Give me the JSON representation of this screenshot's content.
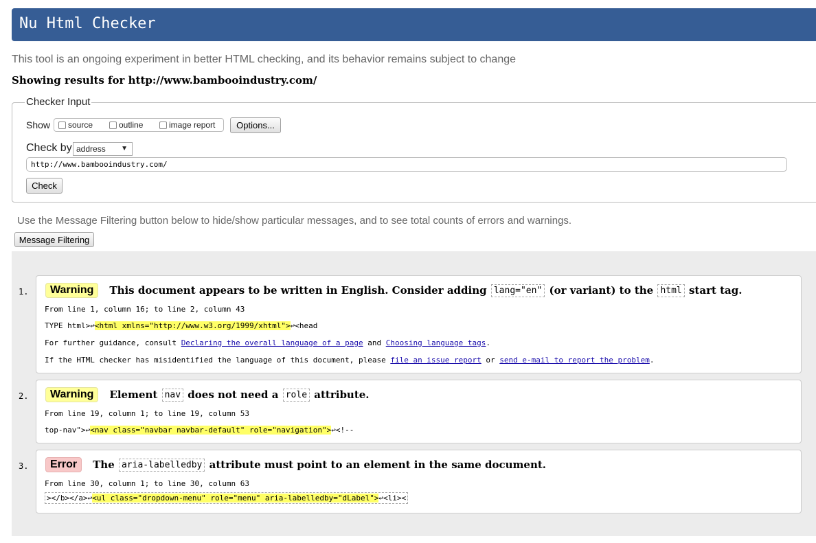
{
  "app": {
    "title": "Nu Html Checker"
  },
  "subtitle": "This tool is an ongoing experiment in better HTML checking, and its behavior remains subject to change",
  "showing_results": "Showing results for http://www.bambooindustry.com/",
  "checker_input": {
    "legend": "Checker Input",
    "show_label": "Show",
    "show_options": [
      {
        "label": "source",
        "checked": false
      },
      {
        "label": "outline",
        "checked": false
      },
      {
        "label": "image report",
        "checked": false
      }
    ],
    "options_button": "Options...",
    "check_by_label": "Check by",
    "check_by_value": "address",
    "url_value": "http://www.bambooindustry.com/",
    "check_button": "Check"
  },
  "filtering": {
    "text": "Use the Message Filtering button below to hide/show particular messages, and to see total counts of errors and warnings.",
    "button": "Message Filtering"
  },
  "messages": [
    {
      "num": "1.",
      "type": "Warning",
      "text1": "This document appears to be written in English. Consider adding",
      "code1": "lang=\"en\"",
      "text2": "(or variant) to the",
      "code2": "html",
      "text3": "start tag.",
      "location": "From line 1, column 16; to line 2, column 43",
      "extract_pre": "TYPE html>↩",
      "extract_hl": "<html xmlns=\"http://www.w3.org/1999/xhtml\">",
      "extract_post": "↩<head",
      "guidance_pre": "For further guidance, consult",
      "guidance_link1": "Declaring the overall language of a page",
      "guidance_and": "and",
      "guidance_link2": "Choosing language tags",
      "guidance_end": ".",
      "misid_pre": "If the HTML checker has misidentified the language of this document, please",
      "misid_link1": "file an issue report",
      "misid_or": "or",
      "misid_link2": "send e-mail to report the problem",
      "misid_end": "."
    },
    {
      "num": "2.",
      "type": "Warning",
      "text1": "Element",
      "code1": "nav",
      "text2": "does not need a",
      "code2": "role",
      "text3": "attribute.",
      "location": "From line 19, column 1; to line 19, column 53",
      "extract_pre": "top-nav\">↩",
      "extract_hl": "<nav class=\"navbar navbar-default\" role=\"navigation\">",
      "extract_post": "↩<!--"
    },
    {
      "num": "3.",
      "type": "Error",
      "text1": "The",
      "code1": "aria-labelledby",
      "text2": "attribute must point to an element in the same document.",
      "location": "From line 30, column 1; to line 30, column 63",
      "extract_pre": "></b></a>↩",
      "extract_hl": "<ul class=\"dropdown-menu\" role=\"menu\" aria-labelledby=\"dLabel\">",
      "extract_post": "↩<li><"
    }
  ],
  "colors": {
    "header": "#365d95",
    "warning": "#ffff99",
    "error": "#f8c8c8",
    "highlight": "#ffff66",
    "link": "#1a0dab"
  }
}
